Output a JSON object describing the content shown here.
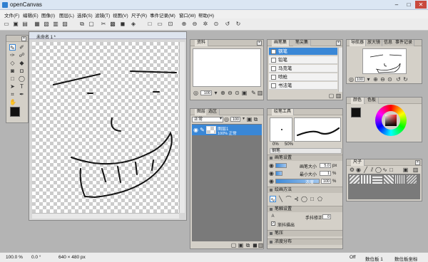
{
  "app": {
    "title": "openCanvas"
  },
  "window_buttons": {
    "min": "–",
    "max": "□",
    "close": "✕"
  },
  "menu": [
    "文件(F)",
    "编辑(E)",
    "图像(I)",
    "图层(L)",
    "选择(S)",
    "滤镜(T)",
    "视图(V)",
    "尺子(R)",
    "事件记录(M)",
    "窗口(W)",
    "帮助(H)"
  ],
  "canvas": {
    "tab_title": "未命名 1 *"
  },
  "materials": {
    "tab": "资料",
    "zoom": "100"
  },
  "brush": {
    "tabs": [
      "画笔集",
      "笔尖集"
    ],
    "items": [
      "钢笔",
      "铅笔",
      "马克笔",
      "喷枪",
      "书法笔"
    ]
  },
  "navigator": {
    "tabs": [
      "导航器",
      "放大镜",
      "信息",
      "事件记录"
    ],
    "zoom": "100"
  },
  "color": {
    "tabs": [
      "颜色",
      "色板"
    ]
  },
  "ruler": {
    "tab": "尺子"
  },
  "layers": {
    "tabs": [
      "图层",
      "选区"
    ],
    "blend_mode": "正常",
    "opacity": "100",
    "layer_name": "图层1",
    "layer_detail": "100% 正常"
  },
  "tool_props": {
    "tab": "绘笔工具",
    "size_label": "0%",
    "size_max": "50%",
    "tool_name": "钢笔",
    "section_brush": "画笔设置",
    "brush_size_label": "画笔大小",
    "brush_size_val": "5.0",
    "unit_px": "px",
    "min_size_label": "最小大小",
    "min_size_val": "1",
    "unit_pct": "%",
    "opacity_label": "浓度",
    "opacity_val": "100",
    "section_method": "绘画方法",
    "section_stroke": "笔触设置",
    "stabilizer_label": "手抖修正",
    "stabilizer_val": "0",
    "taper_label": "渐抖描出",
    "section_pressure": "笔压",
    "section_density": "浓度分布"
  },
  "status": {
    "zoom": "100.0 %",
    "angle": "0.0 °",
    "size": "640 × 480 px",
    "off": "Off",
    "tablet": "数位板 1",
    "tablet_coord": "数位板坐标"
  }
}
